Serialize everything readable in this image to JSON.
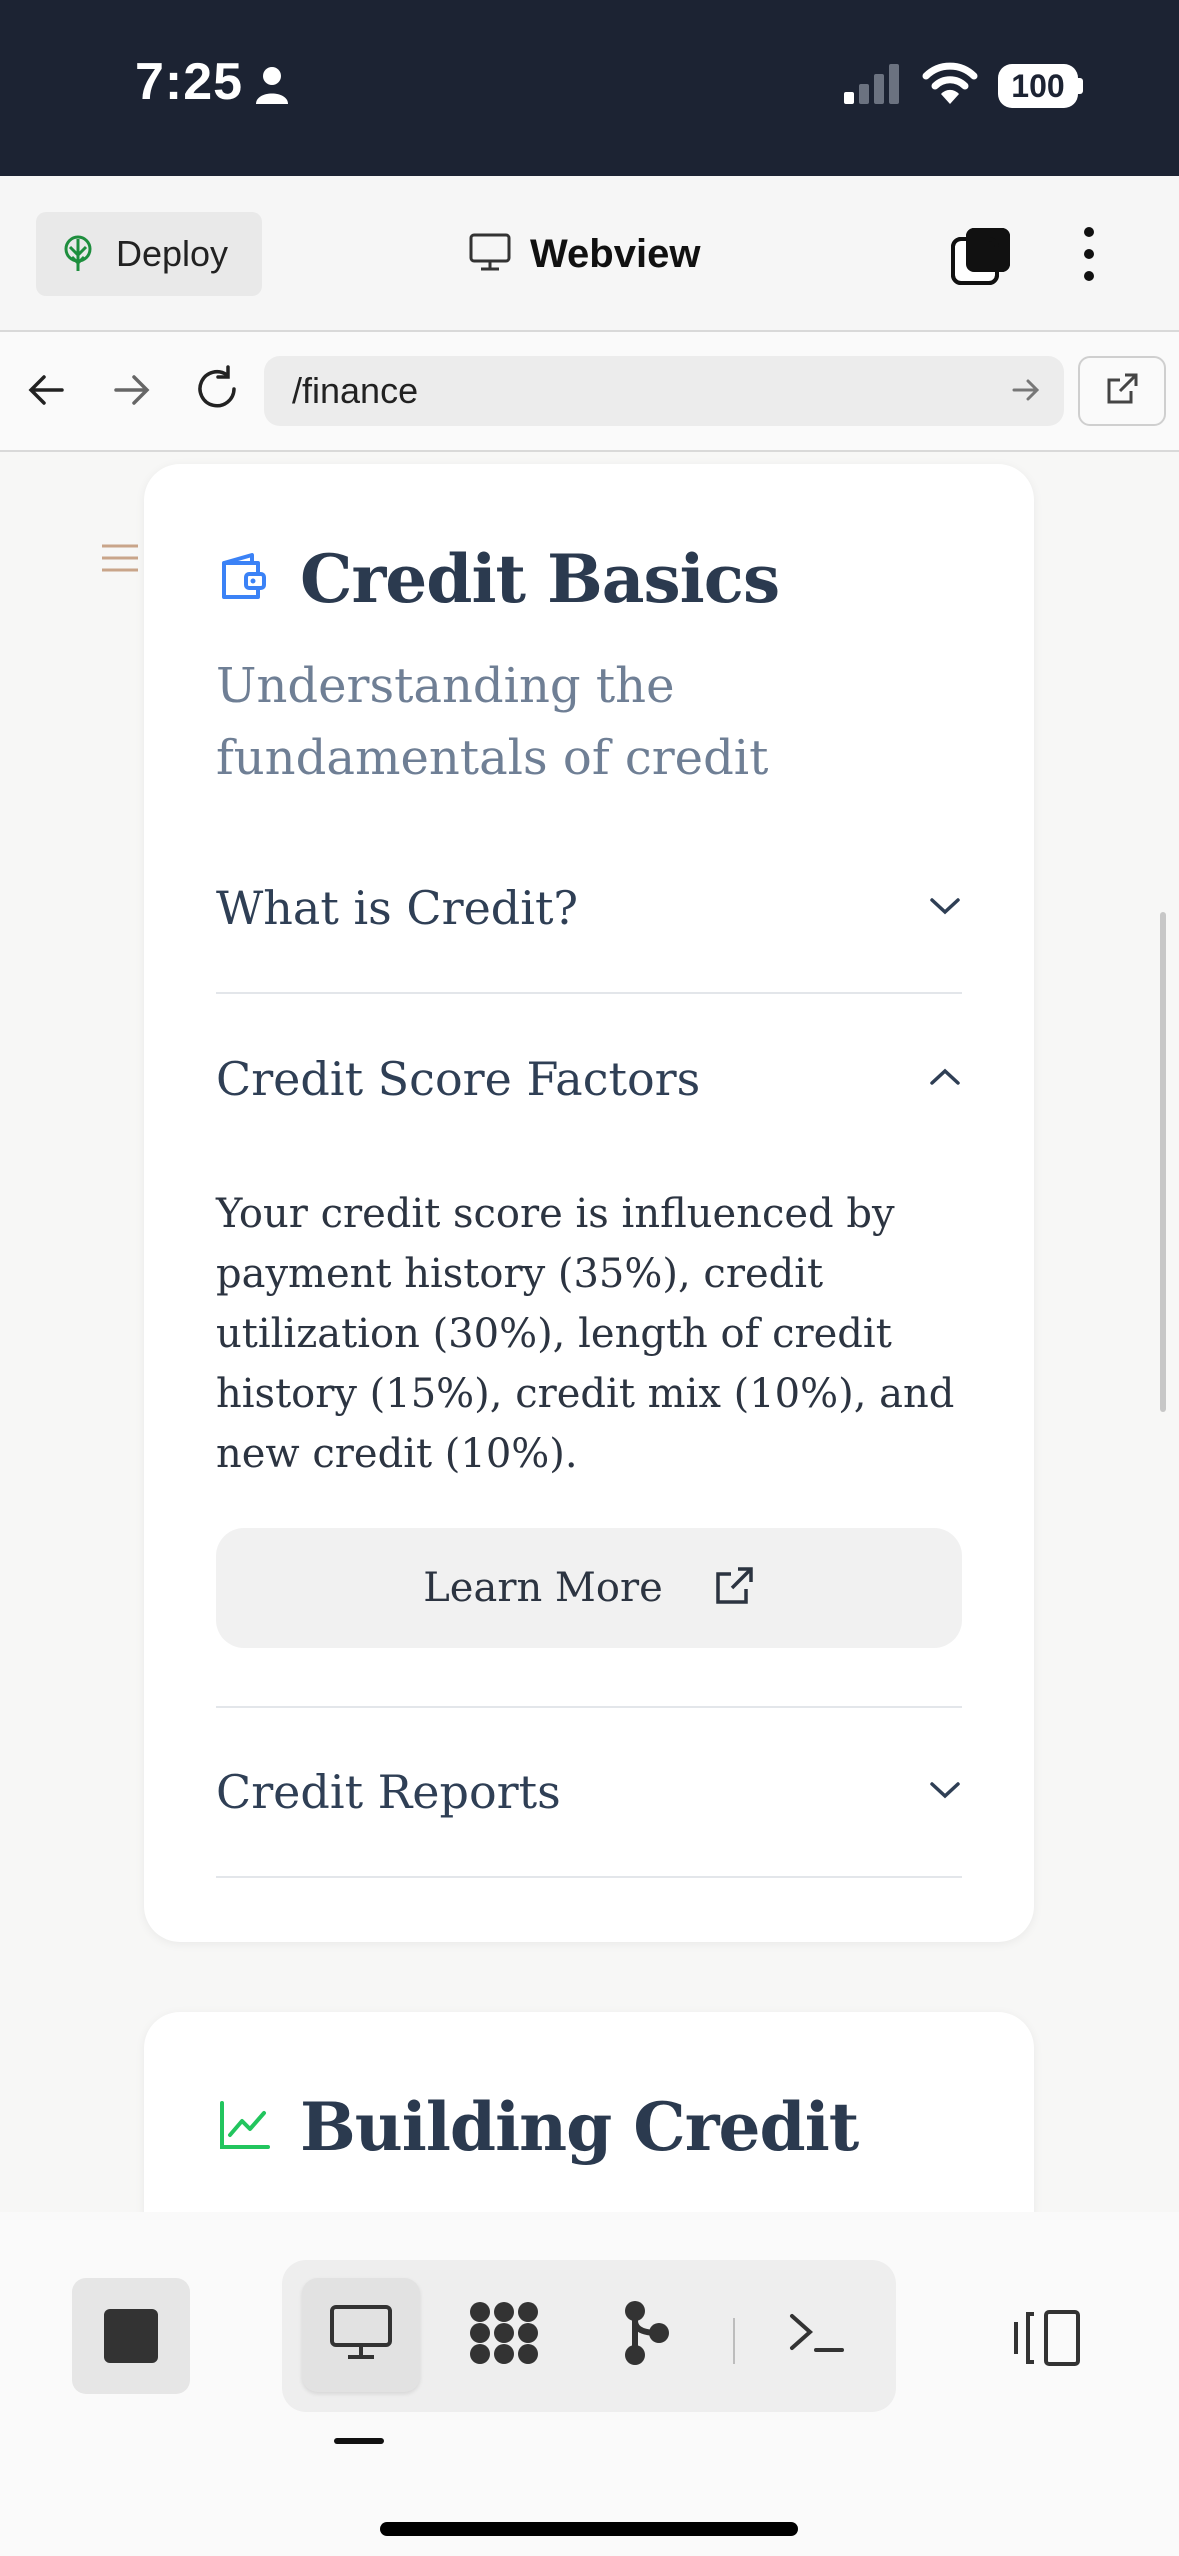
{
  "status_bar": {
    "time": "7:25",
    "battery": "100"
  },
  "toolbar": {
    "deploy_label": "Deploy",
    "title": "Webview"
  },
  "url_bar": {
    "url": "/finance"
  },
  "card": {
    "title": "Credit Basics",
    "subtitle": "Understanding the fundamentals of credit",
    "accordion": [
      {
        "title": "What is Credit?",
        "expanded": false
      },
      {
        "title": "Credit Score Factors",
        "expanded": true,
        "body": "Your credit score is influenced by payment history (35%), credit utilization (30%), length of credit history (15%), credit mix (10%), and new credit (10%).",
        "button_label": "Learn More"
      },
      {
        "title": "Credit Reports",
        "expanded": false
      }
    ]
  },
  "card2": {
    "title": "Building Credit"
  },
  "colors": {
    "status_bar_bg": "#1c2333",
    "title_text": "#2b3a4f",
    "subtitle_text": "#6f7f95",
    "wallet_icon": "#3b82f6",
    "chart_icon": "#22c55e",
    "deploy_icon": "#1e8e3e"
  },
  "icons": [
    "person-icon",
    "signal-icon",
    "wifi-icon",
    "deploy-icon",
    "monitor-icon",
    "panels-icon",
    "kebab-icon",
    "back-arrow-icon",
    "forward-arrow-icon",
    "reload-icon",
    "go-arrow-icon",
    "external-link-icon",
    "hamburger-icon",
    "wallet-icon",
    "chevron-down-icon",
    "chevron-up-icon",
    "chart-line-icon",
    "stop-icon",
    "apps-grid-icon",
    "git-branch-icon",
    "terminal-icon",
    "panel-toggle-icon"
  ]
}
